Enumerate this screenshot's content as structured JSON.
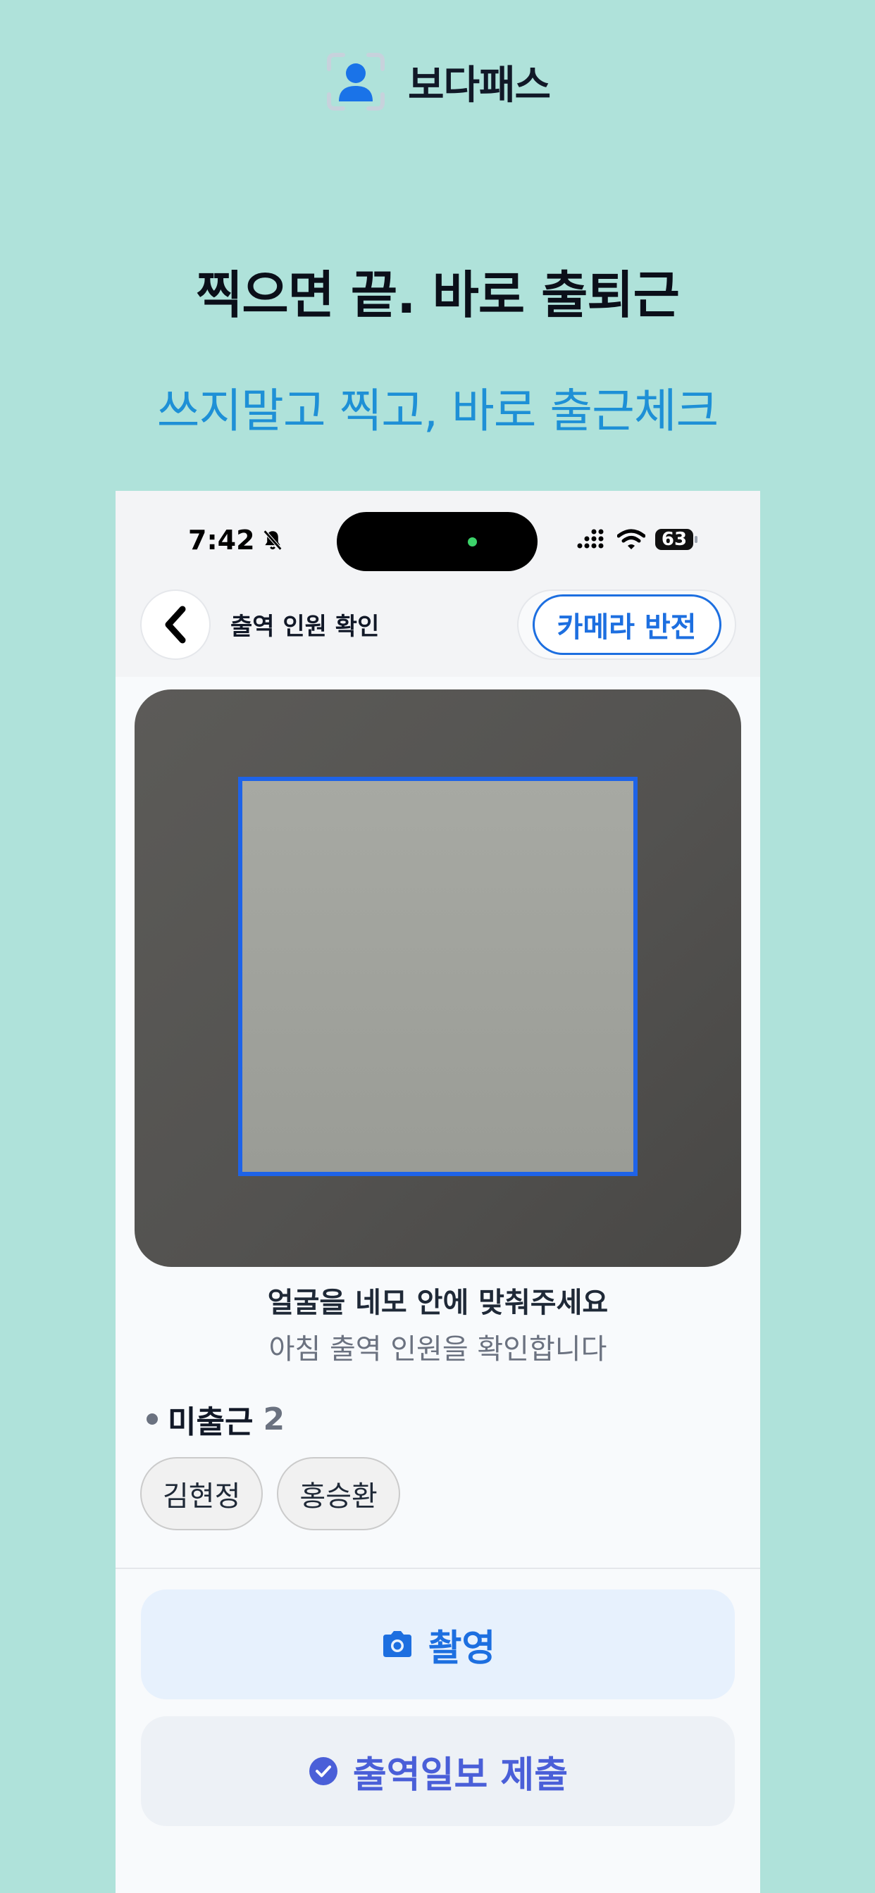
{
  "brand": {
    "name": "보다패스",
    "logo_icon": "user-scan-icon"
  },
  "headline": "찍으면 끝. 바로 출퇴근",
  "subline": "쓰지말고 찍고, 바로 출근체크",
  "status_bar": {
    "time": "7:42",
    "battery": "63"
  },
  "header": {
    "title": "출역 인원 확인",
    "flip_camera_label": "카메라 반전"
  },
  "camera": {
    "guide": "얼굴을 네모 안에 맞춰주세요",
    "guide_sub": "아침 출역 인원을 확인합니다"
  },
  "absent": {
    "label": "미출근",
    "count": "2",
    "names": [
      "김현정",
      "홍승환"
    ]
  },
  "actions": {
    "shoot_label": "촬영",
    "submit_label": "출역일보 제출"
  },
  "colors": {
    "background": "#afe2da",
    "accent": "#1d6fe0",
    "subline": "#1e90d6"
  }
}
